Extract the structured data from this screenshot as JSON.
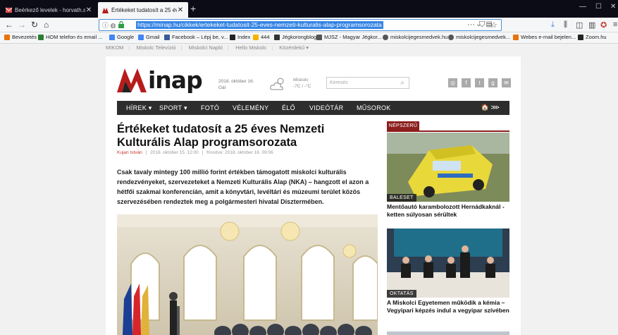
{
  "browser": {
    "tabs": [
      {
        "title": "Beérkező levelek - horvath.szo"
      },
      {
        "title": "Értékeket tudatosít a 25 éves N"
      }
    ],
    "new_tab": "+",
    "url": "https://minap.hu/cikkek/ertekeket-tudatosit-25-eves-nemzeti-kulturalis-alap-programsorozata",
    "more": "···",
    "bookmarks": [
      {
        "label": "Bevezetés",
        "color": "#e8730c"
      },
      {
        "label": "HOM telefon és email ...",
        "color": "#2e7d32"
      },
      {
        "label": "Google",
        "color": "#4285f4"
      },
      {
        "label": "Gmail",
        "color": "#4285f4"
      },
      {
        "label": "Facebook – Lépj be, v...",
        "color": "#3b5998"
      },
      {
        "label": "Index",
        "color": "#222222"
      },
      {
        "label": "444",
        "color": "#f4b400"
      },
      {
        "label": "Jégkorongblog",
        "color": "#333333"
      },
      {
        "label": "MJSZ - Magyar Jégkor...",
        "color": "#555555"
      },
      {
        "label": "miskolcijegesmedvek.hu",
        "color": "#555555"
      },
      {
        "label": "miskolcijegesmedvek...",
        "color": "#555555"
      },
      {
        "label": "Webes e-mail bejelen...",
        "color": "#e8730c"
      },
      {
        "label": "Zoom.hu",
        "color": "#222222"
      }
    ]
  },
  "site": {
    "topnav": [
      "MIKOM",
      "Miskolc Televízió",
      "Miskolci Napló",
      "Hello Miskolc",
      "Közérdekű ▾"
    ],
    "logo_text": "inap",
    "date_line1": "2018. október 16.",
    "date_line2": "Gál",
    "weather_line1": "Miskolc",
    "weather_line2": "-7C / -°C",
    "search_placeholder": "Keresés",
    "menu": [
      "HÍREK ▾",
      "SPORT ▾",
      "FOTÓ",
      "VÉLEMÉNY",
      "ÉLŐ",
      "VIDEÓTÁR",
      "MŰSOROK"
    ],
    "menu_right": "🏠 ⋙",
    "article": {
      "title": "Értékeket tudatosít a 25 éves Nemzeti Kulturális Alap programsorozata",
      "author": "Kujan István",
      "published": "2018. október 15. 12:00",
      "updated": "frissítve: 2018. október 16. 09:06",
      "lead": "Csak tavaly mintegy 100 millió forint értékben támogatott miskolci kulturális rendezvényeket, szervezeteket a Nemzeti Kulturális Alap (NKA) – hangzott el azon a hétfői szakmai konferencián, amit a könyvtári, levéltári és múzeumi terület közös szervezésében rendeztek meg a polgármesteri hivatal Dísztermében."
    },
    "sidebar": {
      "popular_label": "NÉPSZERŰ",
      "cards": [
        {
          "tag": "BALESET",
          "title": "Mentőautó karambolozott Hernádkaknál - ketten súlyosan sérültek"
        },
        {
          "tag": "OKTATÁS",
          "title": "A Miskolci Egyetemen működik a kémia – Vegyipari képzés indul a vegyipar szívében"
        }
      ]
    }
  }
}
